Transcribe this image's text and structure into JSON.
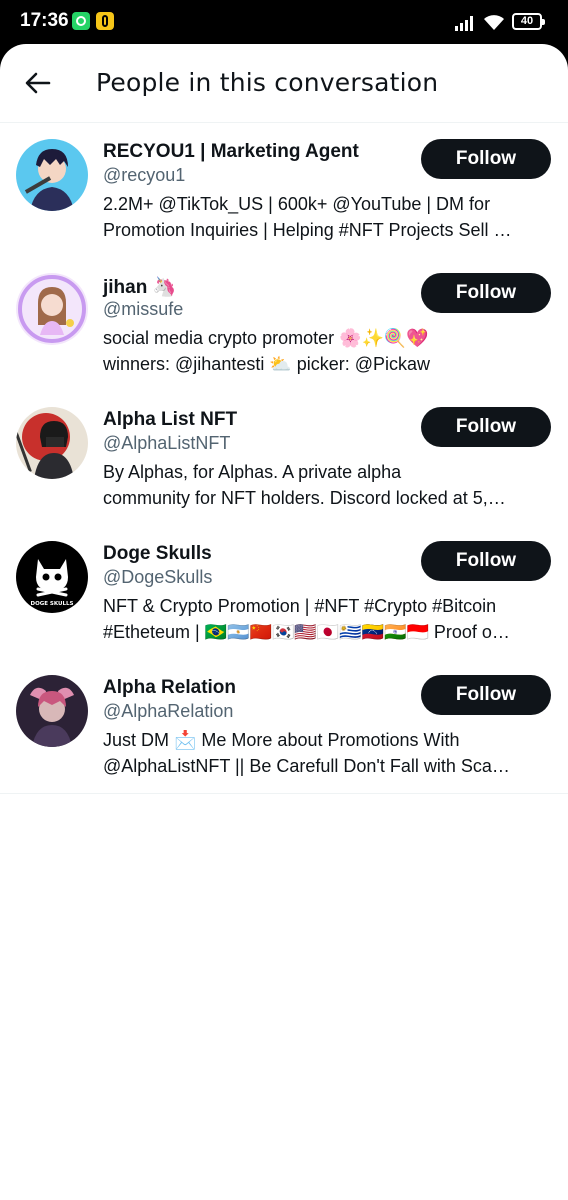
{
  "status_bar": {
    "time": "17:36",
    "battery": "40",
    "icons": [
      "whatsapp-icon",
      "app-notification-icon",
      "signal-icon",
      "wifi-icon",
      "battery-icon"
    ]
  },
  "header": {
    "title": "People in this conversation",
    "back_icon": "arrow-left-icon"
  },
  "users": [
    {
      "name": "RECYOU1 | Marketing Agent",
      "handle": "@recyou1",
      "bio_lines": [
        "2.2M+ @TikTok_US | 600k+ @YouTube | DM for",
        "Promotion Inquiries | Helping #NFT Projects Sell …"
      ],
      "follow_label": "Follow",
      "avatar_color": "#5bc8ef"
    },
    {
      "name": "jihan 🦄",
      "handle": "@missufe",
      "bio_lines": [
        "social media crypto promoter 🌸✨🍭💖",
        "winners: @jihantesti ⛅ picker: @Pickaw"
      ],
      "follow_label": "Follow",
      "avatar_color": "#d9a6f0"
    },
    {
      "name": "Alpha List NFT",
      "handle": "@AlphaListNFT",
      "bio_lines": [
        "By Alphas, for Alphas. A private alpha",
        "community for NFT holders. Discord locked at 5,…"
      ],
      "follow_label": "Follow",
      "avatar_color": "#c8302c"
    },
    {
      "name": "Doge Skulls",
      "handle": "@DogeSkulls",
      "bio_lines": [
        "NFT & Crypto Promotion | #NFT #Crypto #Bitcoin",
        "#Etheteum | 🇧🇷🇦🇷🇨🇳🇰🇷🇺🇸🇯🇵🇺🇾🇻🇪🇮🇳🇮🇩 Proof o…"
      ],
      "follow_label": "Follow",
      "avatar_color": "#000000",
      "avatar_text": "DOGE SKULLS"
    },
    {
      "name": "Alpha Relation",
      "handle": "@AlphaRelation",
      "bio_lines": [
        "Just DM 📩 Me More about Promotions With",
        "@AlphaListNFT || Be Carefull Don't Fall with Sca…"
      ],
      "follow_label": "Follow",
      "avatar_color": "#3a2a4a"
    }
  ]
}
